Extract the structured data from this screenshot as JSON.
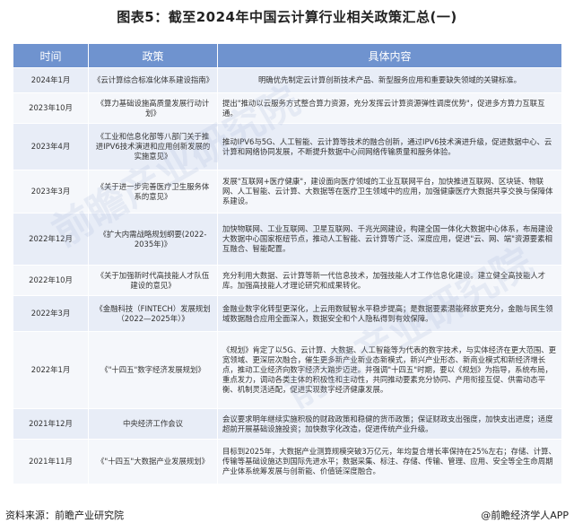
{
  "title": "图表5：截至2024年中国云计算行业相关政策汇总(一)",
  "headers": {
    "time": "时间",
    "policy": "政策",
    "content": "具体内容"
  },
  "rows": [
    {
      "time": "2024年1月",
      "policy": "《云计算综合标准化体系建设指南》",
      "content": "明确优先制定云计算创新技术产品、新型服务应用和重要缺失领域的关键标准。",
      "align": "center"
    },
    {
      "time": "2023年10月",
      "policy": "《算力基础设施高质量发展行动计划》",
      "content": "提出\"推动以云服务方式整合算力资源，充分发挥云计算资源弹性调度优势\"，促进多方算力互联互通。",
      "align": "left"
    },
    {
      "time": "2023年4月",
      "policy": "《工业和信息化部等八部门关于推进IPV6技术演进和应用创新发展的实施意见》",
      "content": "推动IPV6与5G、人工智能、云计算等技术的融合创新，通过IPV6技术演进升级，促进数据中心、云计算和网络协同发展，不断提升数据中心间网络传输质量和服务体验。",
      "align": "left"
    },
    {
      "time": "2023年3月",
      "policy": "《关于进一步完善医疗卫生服务体系的意见》",
      "content": "发展\"互联网+医疗健康\"，建设面向医疗领域的工业互联网平台，加快推进互联网、区块链、物联网、人工智能、云计算、大数据等在医疗卫生领域中的应用，加强健康医疗大数据共享交换与保障体系建设。",
      "align": "left"
    },
    {
      "time": "2022年12月",
      "policy": "《扩大内需战略规划纲要(2022-2035年)》",
      "content": "加快物联网、工业互联网、卫星互联网、千兆光网建设，构建全国一体化大数据中心体系，布局建设大数据中心国家枢纽节点，推动人工智能、云计算等广泛、深度应用，促进\"云、网、端\"资源要素相互融合、智能配置。",
      "align": "left"
    },
    {
      "time": "2022年10月",
      "policy": "《关于加强新时代高技能人才队伍建设的意见》",
      "content": "充分利用大数据、云计算等新一代信息技术，加强技能人才工作信息化建设。建立健全高技能人才库。加强高技能人才理论研究和成果转化。",
      "align": "left"
    },
    {
      "time": "2022年3月",
      "policy": "《金融科技（FINTECH）发展规划（2022—2025年）》",
      "content": "金融业数字化转型更深化，上云用数赋智水平稳步提高；是数据要素潜能释放更充分，金融与民生领域数据融合应用全面深入，数据安全和个人隐私得到有效保障。",
      "align": "left"
    },
    {
      "time": "2022年1月",
      "policy": "《\"十四五\"数字经济发展规划》",
      "content": "《规划》肯定了以5G、云计算、大数据、人工智能等为代表的数字技术，与实体经济在更大范围、更宽领域、更深层次融合，催生更多新产业新业态新模式，新兴产业形态、新商业模式和新经济增长点，推动工业经济向数字经济大踏步迈进。并强调\"十四五\"时期，要以《规划》为指导，系统布局，重点发力，调动各类主体的积极性和主动性，共同推动要素充分协同、产用衔接互促、供需动态平衡、机制灵活适配，促进实现数字经济健康发展。",
      "align": "left"
    },
    {
      "time": "2021年12月",
      "policy": "中央经济工作会议",
      "content": "会议要求明年继续实施积极的财政政策和稳健的货币政策；保证财政支出强度，加快支出进度；适度超前开展基础设施投资；加快数字化改造，促进传统产业升级。",
      "align": "left"
    },
    {
      "time": "2021年11月",
      "policy": "《\"十四五\"大数据产业发展规划》",
      "content": "目标到2025年，大数据产业测算规模突破3万亿元，年均复合增长率保持在25%左右；存储、计算、传输等基础设施达到国际先进水平；数据采集、标注、存储、传输、管理、应用、安全等全生命周期产业体系统筹发展与创新能、价值链深度融合。",
      "align": "left"
    }
  ],
  "footer": {
    "source": "资料来源：前瞻产业研究院",
    "brand": "@前瞻经济学人APP"
  },
  "watermark": "前瞻产业研究院",
  "colors": {
    "header": "#6f93cf",
    "row_odd": "#e8edf7",
    "row_even": "#f5f7fb"
  }
}
